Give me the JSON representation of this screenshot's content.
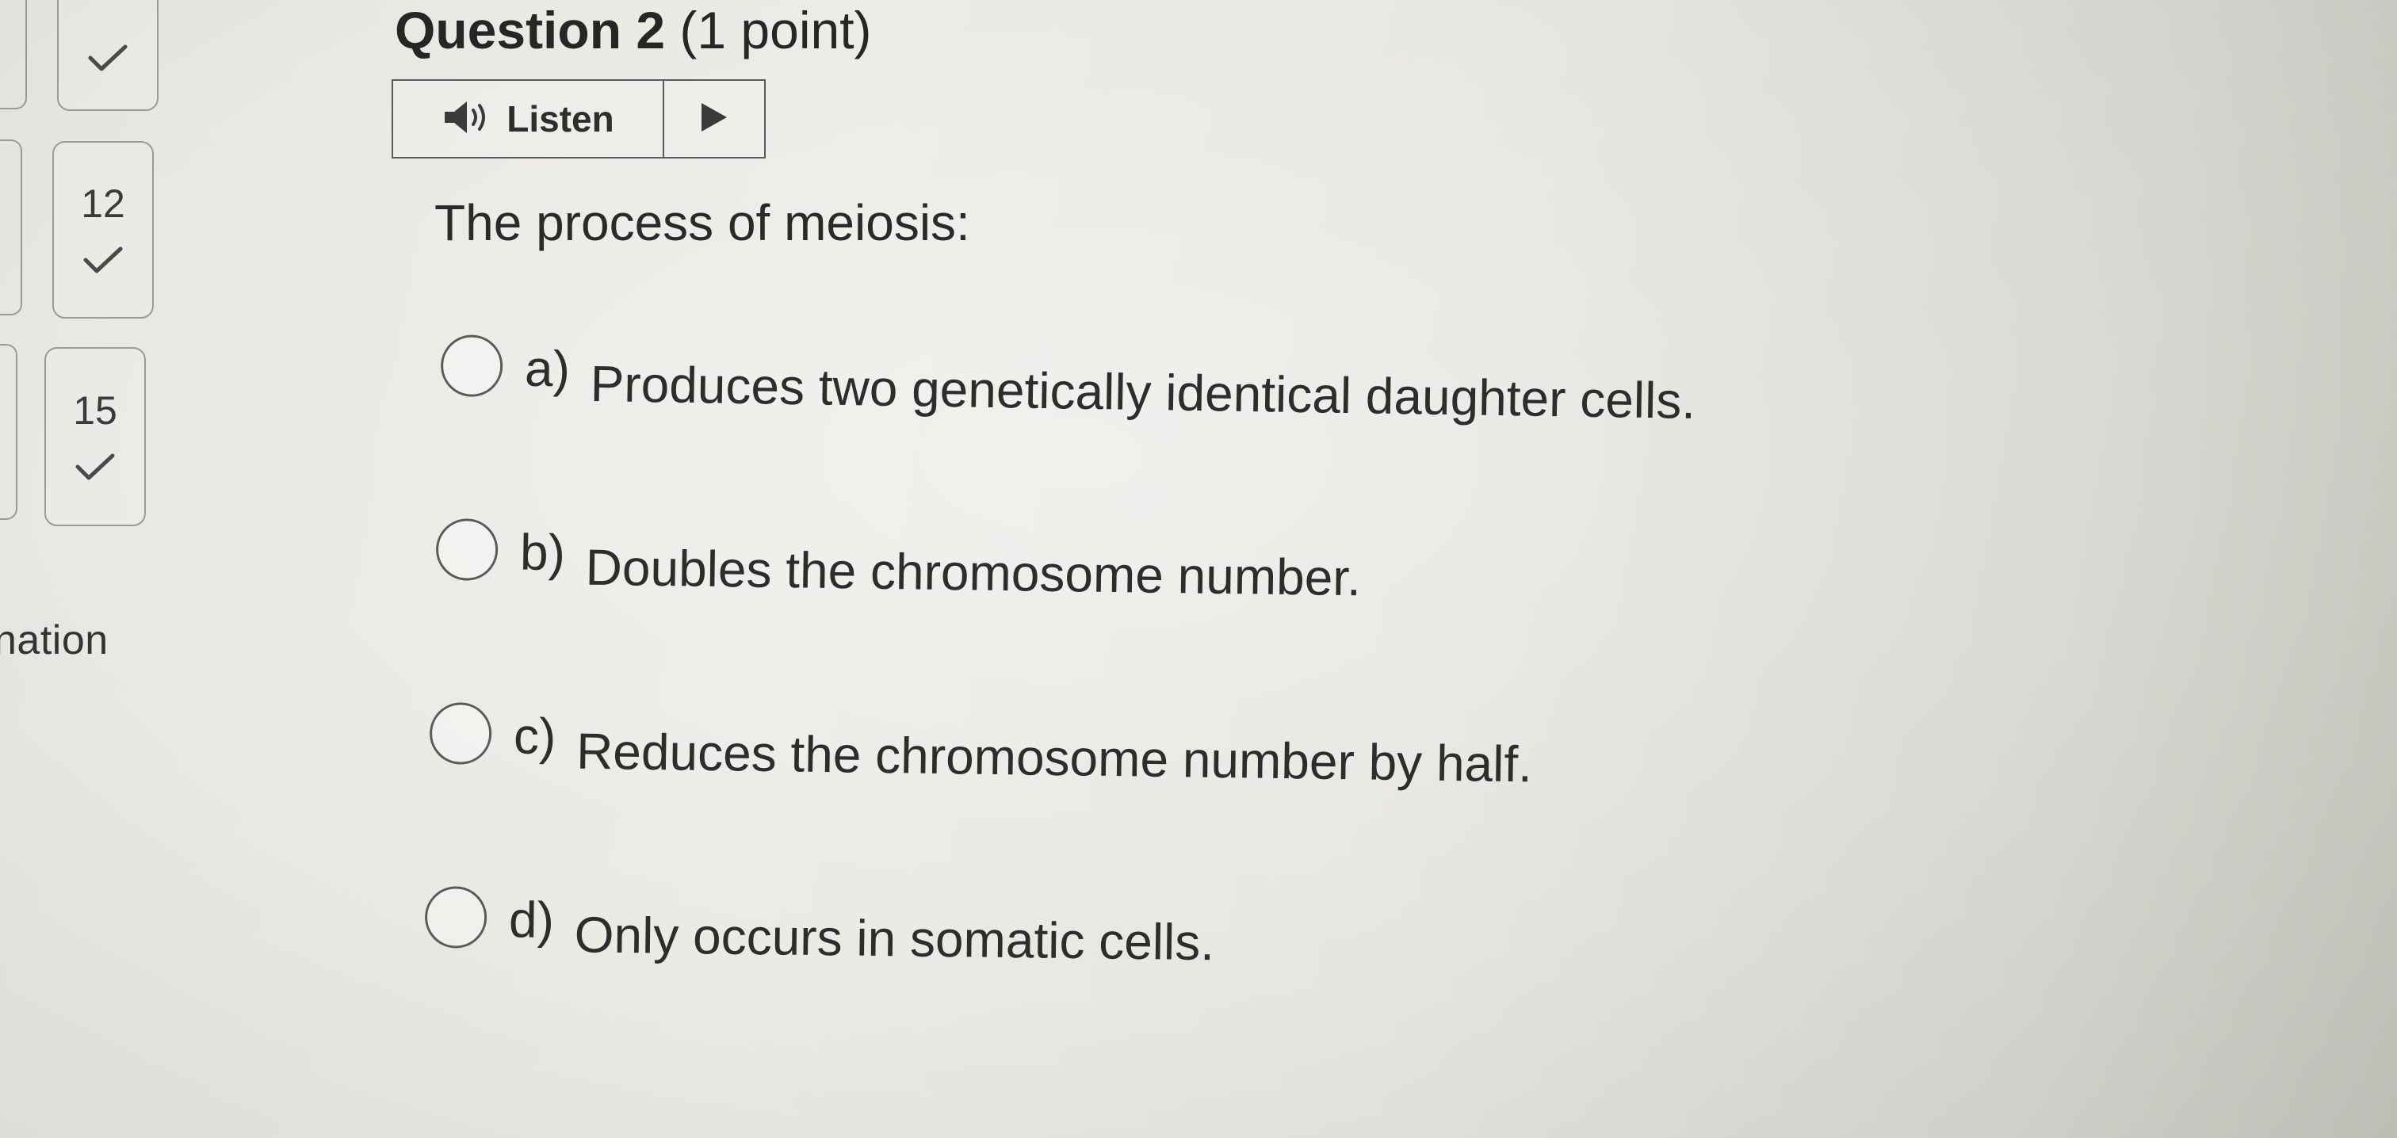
{
  "navigator": {
    "cards": [
      {
        "number": "",
        "status_icon": "checkmark-icon"
      },
      {
        "number": "12",
        "status_icon": "checkmark-icon"
      },
      {
        "number": "15",
        "status_icon": "checkmark-icon"
      }
    ],
    "partial_label": "nation"
  },
  "question": {
    "title_strong": "Question 2",
    "title_points": "(1 point)",
    "listen_label": "Listen",
    "listen_icon": "speaker-icon",
    "play_icon": "play-icon",
    "prompt": "The process of meiosis:",
    "options": [
      {
        "letter": "a)",
        "text": "Produces two genetically identical daughter cells."
      },
      {
        "letter": "b)",
        "text": "Doubles the chromosome number."
      },
      {
        "letter": "c)",
        "text": "Reduces the chromosome number by half."
      },
      {
        "letter": "d)",
        "text": "Only occurs in somatic cells."
      }
    ]
  },
  "colors": {
    "text": "#2d2d2d",
    "border": "#9a9a98",
    "check": "#4a4a4a"
  }
}
